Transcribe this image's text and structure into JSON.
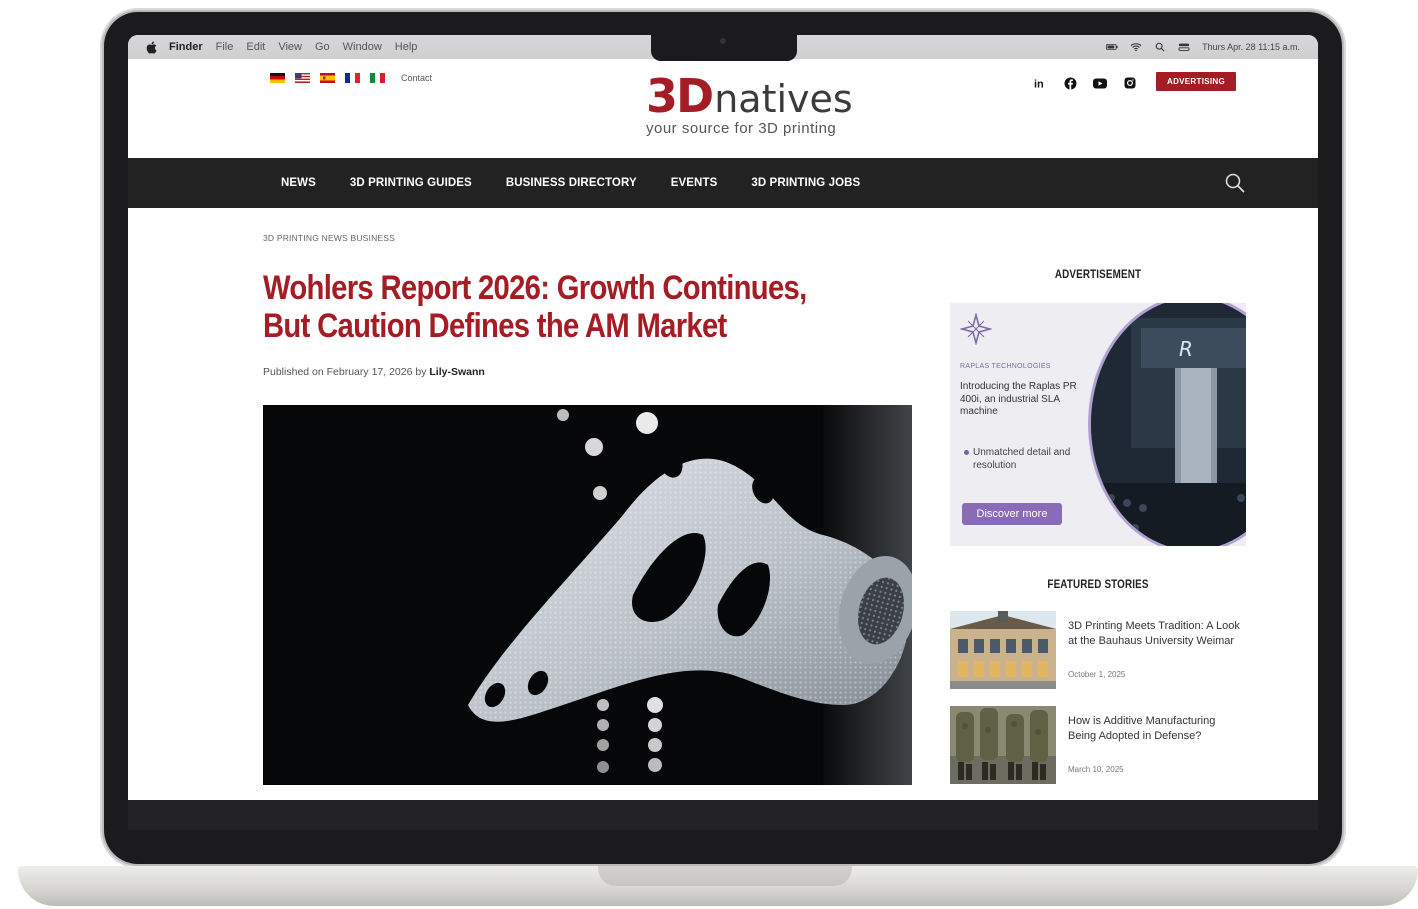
{
  "menubar": {
    "items": [
      "Finder",
      "File",
      "Edit",
      "View",
      "Go",
      "Window",
      "Help"
    ],
    "clock": "Thurs Apr. 28 11:15 a.m."
  },
  "header": {
    "contact_label": "Contact",
    "logo_prefix": "3D",
    "logo_suffix": "natives",
    "tagline": "your source for 3D printing",
    "advertising_label": "ADVERTISING",
    "socials": [
      "linkedin-icon",
      "facebook-icon",
      "youtube-icon",
      "instagram-icon"
    ],
    "flags": [
      "german-flag",
      "us-flag",
      "spanish-flag",
      "french-flag",
      "italian-flag"
    ]
  },
  "nav": {
    "items": [
      "NEWS",
      "3D PRINTING GUIDES",
      "BUSINESS DIRECTORY",
      "EVENTS",
      "3D PRINTING JOBS"
    ]
  },
  "article": {
    "breadcrumb": "3D PRINTING NEWS BUSINESS",
    "title": "Wohlers Report 2026: Growth Continues, But Caution Defines the AM Market",
    "published_prefix": "Published on February 17, 2026 by",
    "author": "Lily-Swann"
  },
  "sidebar": {
    "ad_heading": "ADVERTISEMENT",
    "ad": {
      "brand": "RAPLAS TECHNOLOGIES",
      "text": "Introducing the Raplas PR 400i, an industrial SLA machine",
      "bullet": "Unmatched detail and resolution",
      "cta": "Discover more"
    },
    "featured_heading": "FEATURED STORIES",
    "stories": [
      {
        "title": "3D Printing Meets Tradition: A Look at the Bauhaus University Weimar",
        "date": "October 1, 2025"
      },
      {
        "title": "How is Additive Manufacturing Being Adopted in Defense?",
        "date": "March 10, 2025"
      }
    ]
  },
  "colors": {
    "brand_red": "#a51d24",
    "nav_bg": "#222222",
    "ad_purple": "#8a6bb8"
  }
}
